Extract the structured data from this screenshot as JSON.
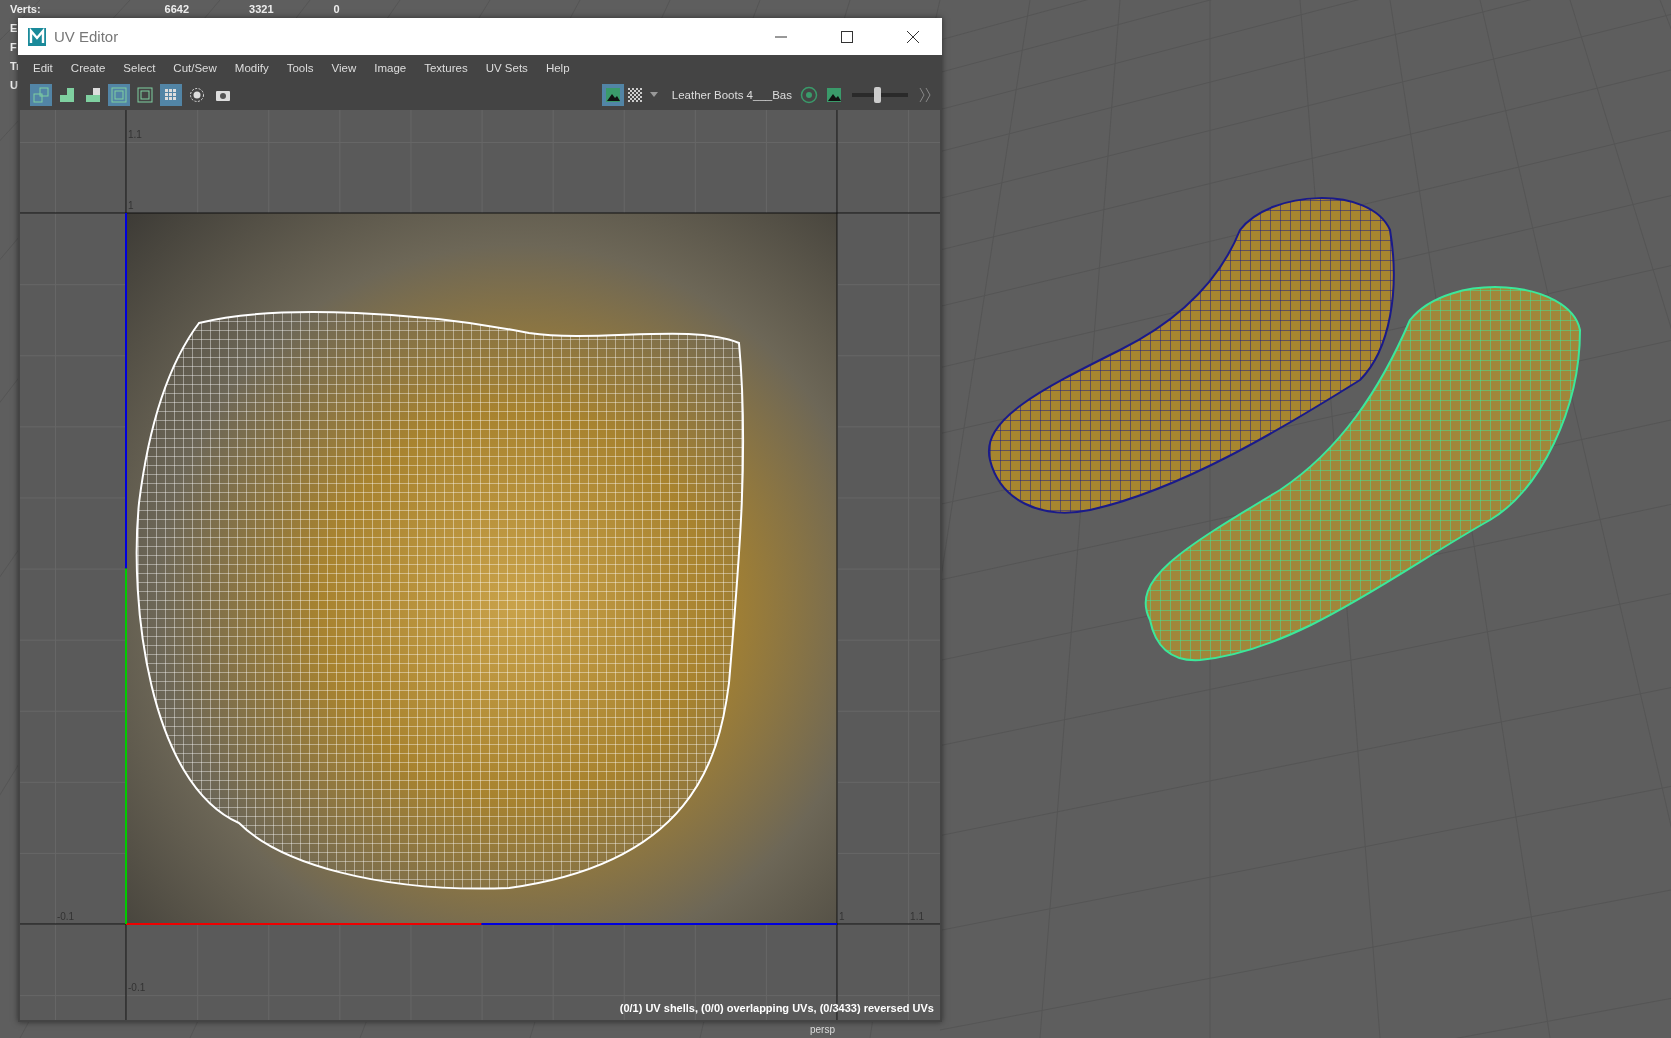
{
  "hud": [
    {
      "label": "Verts:",
      "values": [
        "6642",
        "3321",
        "0"
      ]
    },
    {
      "label": "E"
    },
    {
      "label": "F"
    },
    {
      "label": "Tr"
    },
    {
      "label": "U"
    }
  ],
  "window": {
    "title": "UV Editor",
    "menu": [
      "Edit",
      "Create",
      "Select",
      "Cut/Sew",
      "Modify",
      "Tools",
      "View",
      "Image",
      "Textures",
      "UV Sets",
      "Help"
    ],
    "toolbar": [
      {
        "kind": "shell",
        "selected": true
      },
      {
        "kind": "stack",
        "selected": false
      },
      {
        "kind": "half",
        "selected": false
      },
      {
        "kind": "frame",
        "selected": true
      },
      {
        "kind": "frame",
        "selected": false
      },
      {
        "kind": "dots",
        "selected": true
      },
      {
        "kind": "ring",
        "selected": false
      },
      {
        "kind": "camera",
        "selected": false
      }
    ],
    "image_toggle": {
      "selected": true
    },
    "image_name": "Leather Boots 4___Bas",
    "exposure": {
      "level": 0.45
    },
    "axis_labels": [
      "1.1",
      "1",
      "-0.1",
      "1",
      "1.1",
      "-0.1"
    ],
    "status": "(0/1) UV shells, (0/0) overlapping UVs, (0/3433) reversed UVs"
  },
  "viewport": {
    "camera": "persp"
  }
}
